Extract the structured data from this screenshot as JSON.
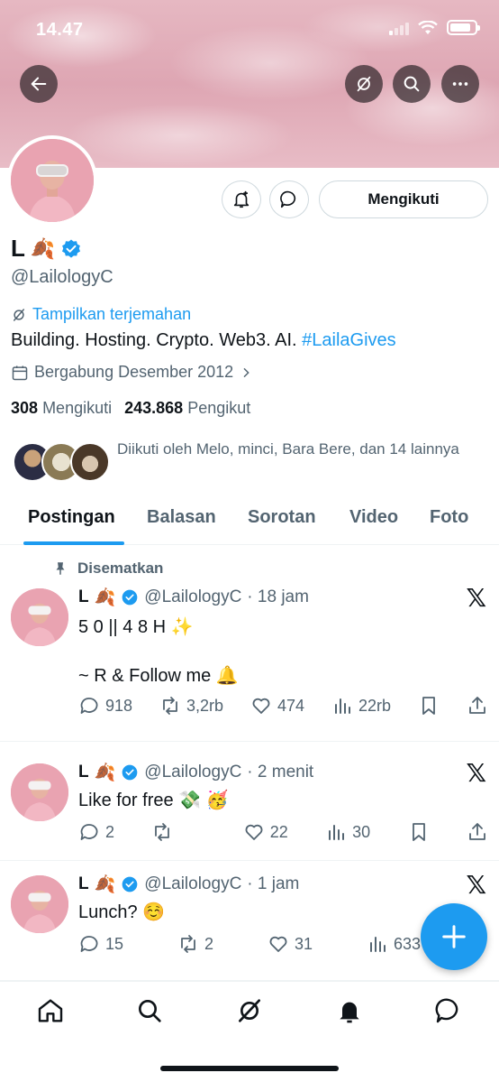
{
  "status": {
    "time": "14.47"
  },
  "profile": {
    "name": "L",
    "name_emoji": "🍂",
    "handle": "@LailologyC",
    "translate_label": "Tampilkan terjemahan",
    "bio_text": "Building. Hosting. Crypto. Web3. AI.",
    "bio_hashtag": "#LailaGives",
    "joined": "Bergabung Desember 2012",
    "following_count": "308",
    "following_label": "Mengikuti",
    "followers_count": "243.868",
    "followers_label": "Pengikut",
    "followed_by": "Diikuti oleh Melo, minci, Bara Bere, dan 14 lainnya",
    "follow_button": "Mengikuti"
  },
  "tabs": [
    "Postingan",
    "Balasan",
    "Sorotan",
    "Video",
    "Foto"
  ],
  "pinned_label": "Disematkan",
  "posts": [
    {
      "name": "L",
      "emoji": "🍂",
      "handle": "@LailologyC",
      "time": "· 18 jam",
      "line1": "5 0 || 4 8 H ✨",
      "line2": "~ R & Follow me 🔔",
      "replies": "918",
      "reposts": "3,2rb",
      "likes": "474",
      "views": "22rb"
    },
    {
      "name": "L",
      "emoji": "🍂",
      "handle": "@LailologyC",
      "time": "· 2 menit",
      "line1": "Like for free 💸 🥳",
      "replies": "2",
      "reposts": "",
      "likes": "22",
      "views": "30"
    },
    {
      "name": "L",
      "emoji": "🍂",
      "handle": "@LailologyC",
      "time": "· 1 jam",
      "line1": "Lunch? ☺️",
      "replies": "15",
      "reposts": "2",
      "likes": "31",
      "views": "633"
    }
  ],
  "colors": {
    "accent": "#1d9bf0",
    "text": "#0f1419",
    "muted": "#536471"
  }
}
